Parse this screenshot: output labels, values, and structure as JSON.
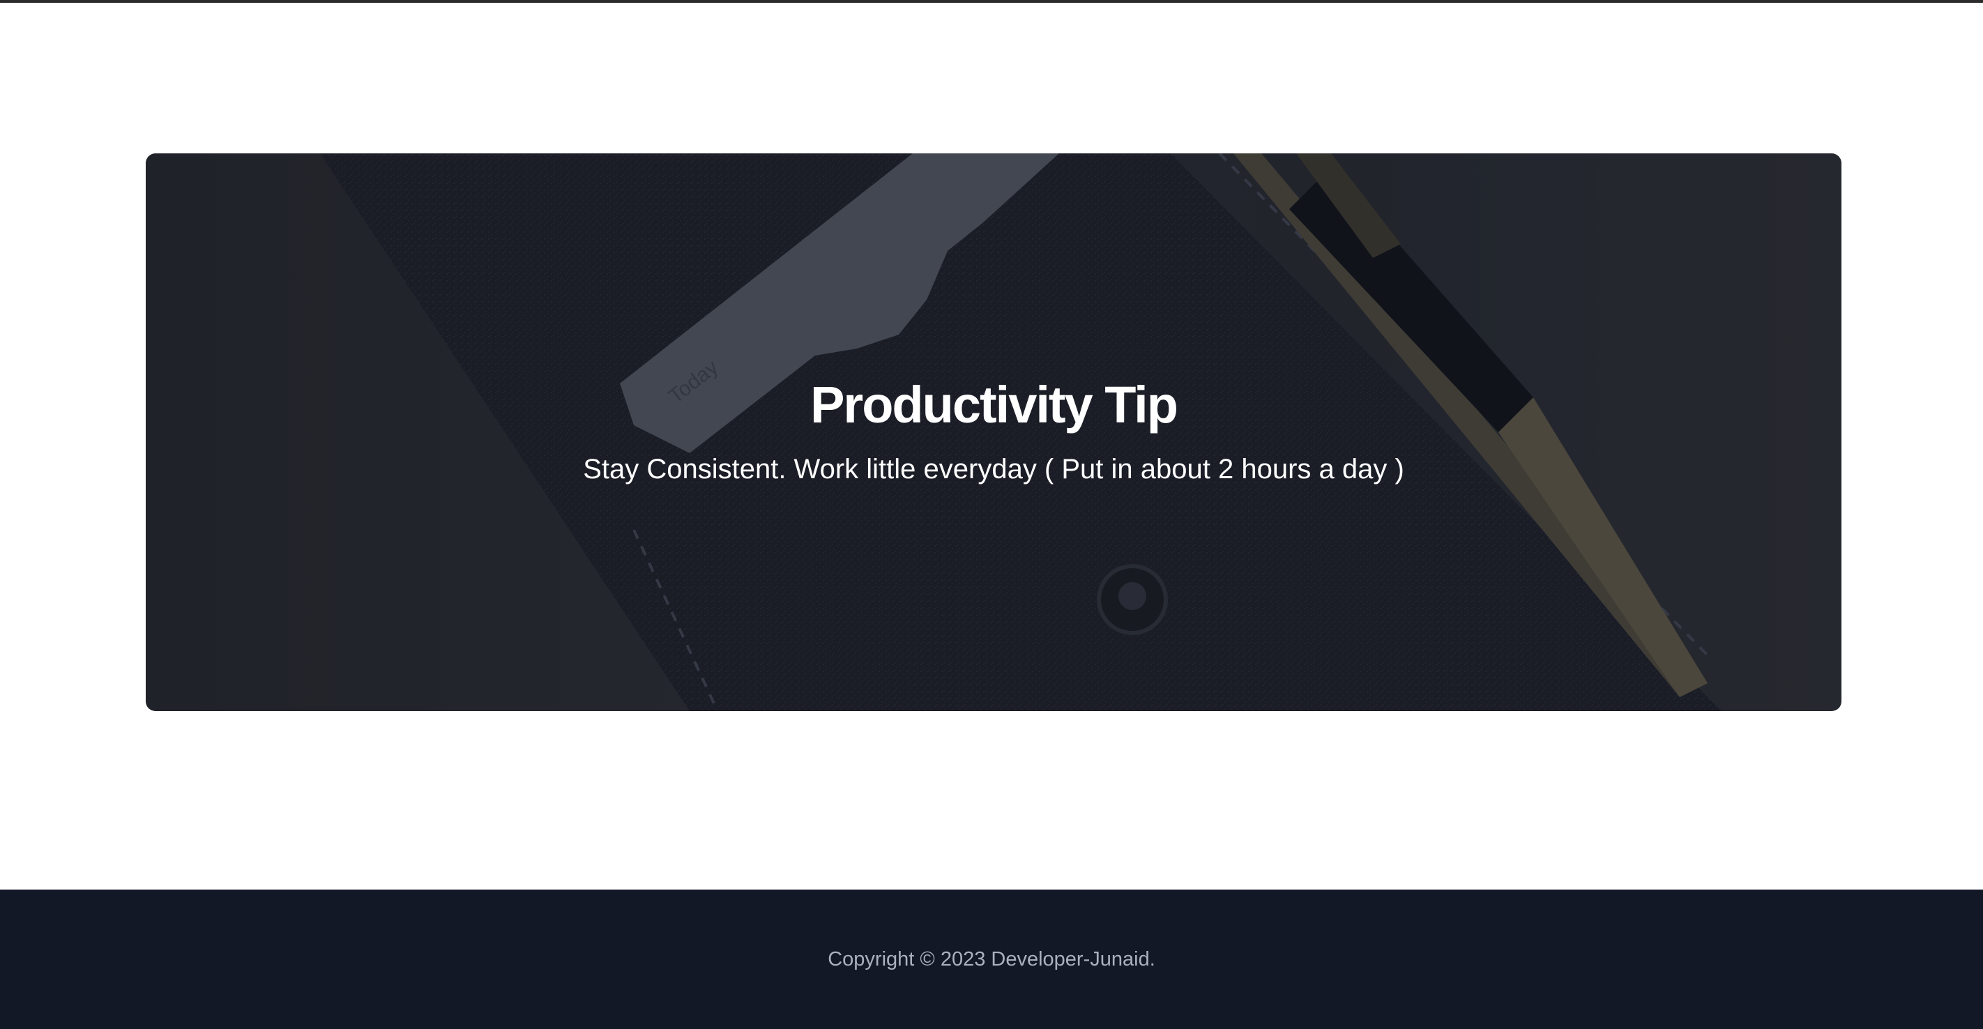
{
  "hero": {
    "title": "Productivity Tip",
    "subtitle": "Stay Consistent. Work little everyday ( Put in about 2 hours a day )",
    "image_card_label": "Today",
    "background_image": "felt-sleeve-with-notecard-and-pen"
  },
  "footer": {
    "copyright": "Copyright © 2023 Developer-Junaid."
  },
  "colors": {
    "footer_bg": "#131826",
    "footer_text": "#aab0bd",
    "hero_text": "#ffffff",
    "page_bg": "#ffffff"
  }
}
